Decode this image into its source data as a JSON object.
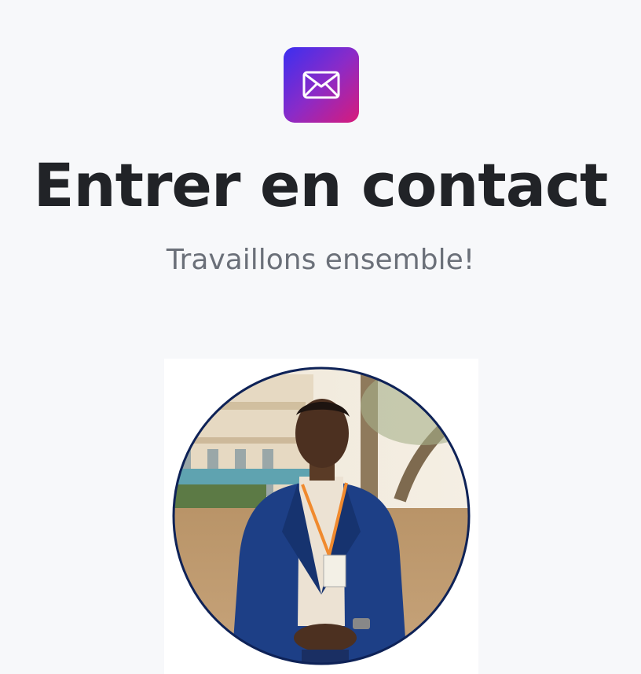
{
  "contact": {
    "icon": "envelope-icon",
    "title": "Entrer en contact",
    "subtitle": "Travaillons ensemble!",
    "photo": "profile-photo"
  },
  "colors": {
    "background": "#f7f8fa",
    "title": "#212327",
    "subtitle": "#6b7079",
    "gradient_start": "#3b2ff0",
    "gradient_end": "#d81b7a",
    "photo_ring": "#0e2257"
  }
}
